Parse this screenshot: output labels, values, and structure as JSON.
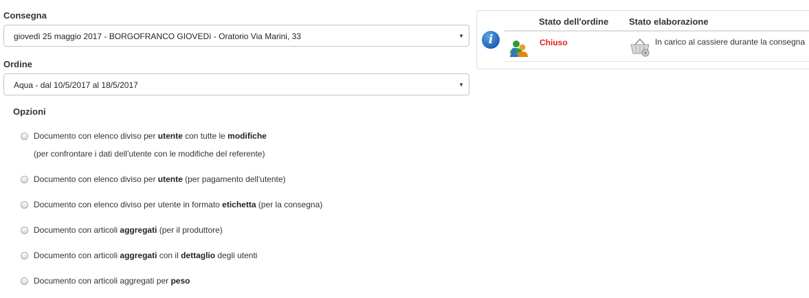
{
  "consegna": {
    "label": "Consegna",
    "selected": "giovedì 25 maggio 2017 - BORGOFRANCO GIOVEDì - Oratorio Via Marini, 33"
  },
  "ordine": {
    "label": "Ordine",
    "selected": "Aqua - dal 10/5/2017 al 18/5/2017"
  },
  "opzioni": {
    "title": "Opzioni",
    "items": [
      {
        "p1": "Documento con elenco diviso per ",
        "b1": "utente",
        "p2": " con tutte le ",
        "b2": "modifiche",
        "p3": "",
        "sub": "(per confrontare i dati dell'utente con le modifiche del referente)"
      },
      {
        "p1": "Documento con elenco diviso per ",
        "b1": "utente",
        "p2": " (per pagamento dell'utente)"
      },
      {
        "p1": "Documento con elenco diviso per utente in formato ",
        "b1": "etichetta",
        "p2": " (per la consegna)"
      },
      {
        "p1": "Documento con articoli ",
        "b1": "aggregati",
        "p2": " (per il produttore)"
      },
      {
        "p1": "Documento con articoli ",
        "b1": "aggregati",
        "p2": " con il ",
        "b2": "dettaglio",
        "p3": " degli utenti"
      },
      {
        "p1": "Documento con articoli aggregati per ",
        "b1": "peso",
        "p2": ""
      }
    ]
  },
  "stato_panel": {
    "col1": "Stato dell'ordine",
    "col2": "Stato elaborazione",
    "stato": "Chiuso",
    "stato_color": "#e02020",
    "elaborazione": "In carico al cassiere durante la consegna",
    "icons": [
      "info-icon",
      "users-icon",
      "basket-icon"
    ]
  }
}
